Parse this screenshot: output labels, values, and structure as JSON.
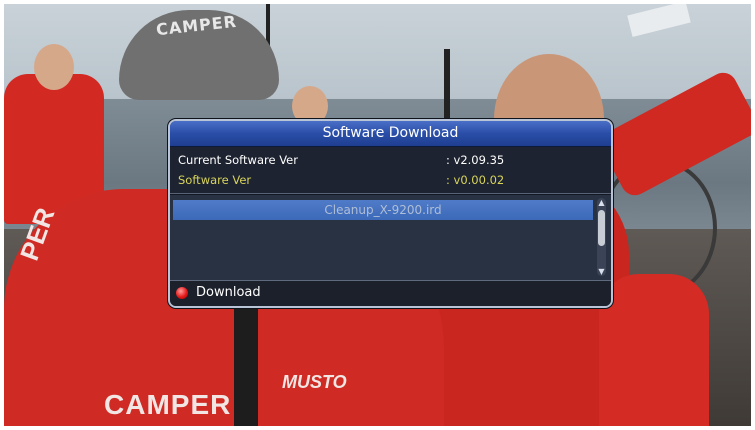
{
  "background": {
    "cap_text": "CAMPER",
    "jacket_text": "CAMPER",
    "side_text": "PER",
    "logo_text": "MUSTO"
  },
  "dialog": {
    "title": "Software Download",
    "current_version_label": "Current Software Ver",
    "current_version_value": ": v2.09.35",
    "software_version_label": "Software Ver",
    "software_version_value": ": v0.00.02",
    "files": [
      "Cleanup_X-9200.ird"
    ],
    "selected_index": 0,
    "footer_action": "Download",
    "colors": {
      "title_bar": "#2a4ea8",
      "selection": "#3c69b8",
      "highlight_text": "#d8d45a",
      "action_button": "#e51919"
    }
  }
}
